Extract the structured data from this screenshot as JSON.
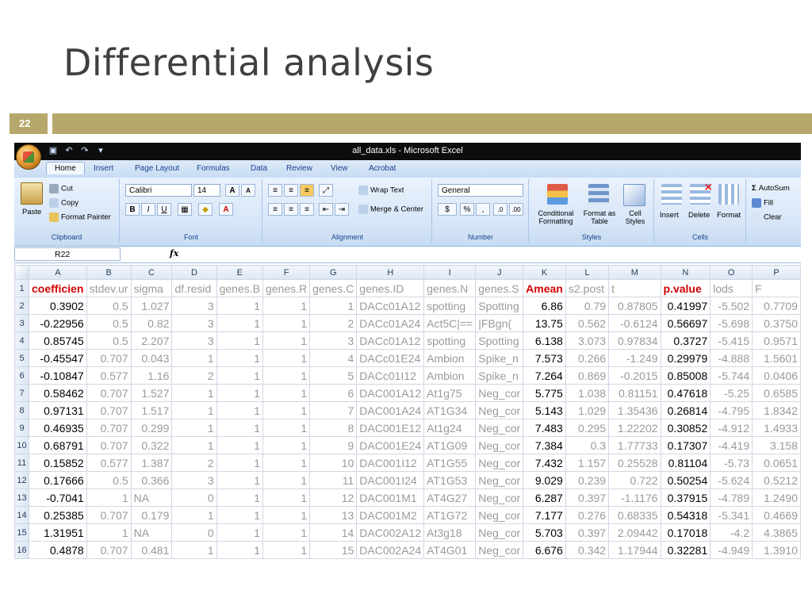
{
  "slide": {
    "title": "Differential analysis",
    "number": "22"
  },
  "window": {
    "title": "all_data.xls - Microsoft Excel"
  },
  "ribbon": {
    "tabs": [
      "Home",
      "Insert",
      "Page Layout",
      "Formulas",
      "Data",
      "Review",
      "View",
      "Acrobat"
    ],
    "clipboard": {
      "paste": "Paste",
      "cut": "Cut",
      "copy": "Copy",
      "format_painter": "Format Painter",
      "label": "Clipboard"
    },
    "font": {
      "name": "Calibri",
      "size": "14",
      "bold": "B",
      "italic": "I",
      "underline": "U",
      "label": "Font"
    },
    "alignment": {
      "wrap": "Wrap Text",
      "merge": "Merge & Center",
      "label": "Alignment"
    },
    "number": {
      "format": "General",
      "currency": "$",
      "percent": "%",
      "comma": ",",
      "label": "Number"
    },
    "styles": {
      "conditional": "Conditional Formatting",
      "as_table": "Format as Table",
      "cell_styles": "Cell Styles",
      "label": "Styles"
    },
    "cells": {
      "insert": "Insert",
      "delete": "Delete",
      "format": "Format",
      "label": "Cells"
    },
    "editing": {
      "autosum": "AutoSum",
      "fill": "Fill",
      "clear": "Clear"
    }
  },
  "formula_bar": {
    "name_box": "R22",
    "fx": "fx",
    "content": ""
  },
  "sheet": {
    "columns": [
      "A",
      "B",
      "C",
      "D",
      "E",
      "F",
      "G",
      "H",
      "I",
      "J",
      "K",
      "L",
      "M",
      "N",
      "O",
      "P"
    ],
    "header_row": [
      "coefficien",
      "stdev.ur",
      "sigma",
      "df.resid",
      "genes.B",
      "genes.R",
      "genes.C",
      "genes.ID",
      "genes.N",
      "genes.S",
      "Amean",
      "s2.post",
      "t",
      "p.value",
      "lods",
      "F"
    ],
    "rows": [
      [
        "0.3902",
        "0.5",
        "1.027",
        "3",
        "1",
        "1",
        "1",
        "DACc01A12",
        "spotting",
        "Spotting",
        "6.86",
        "0.79",
        "0.87805",
        "0.41997",
        "-5.502",
        "0.7709"
      ],
      [
        "-0.22956",
        "0.5",
        "0.82",
        "3",
        "1",
        "1",
        "2",
        "DACc01A24",
        "Act5C|==",
        "|FBgn(",
        "13.75",
        "0.562",
        "-0.6124",
        "0.56697",
        "-5.698",
        "0.3750"
      ],
      [
        "0.85745",
        "0.5",
        "2.207",
        "3",
        "1",
        "1",
        "3",
        "DACc01A12",
        "spotting",
        "Spotting",
        "6.138",
        "3.073",
        "0.97834",
        "0.3727",
        "-5.415",
        "0.9571"
      ],
      [
        "-0.45547",
        "0.707",
        "0.043",
        "1",
        "1",
        "1",
        "4",
        "DACc01E24",
        "Ambion",
        "Spike_n",
        "7.573",
        "0.266",
        "-1.249",
        "0.29979",
        "-4.888",
        "1.5601"
      ],
      [
        "-0.10847",
        "0.577",
        "1.16",
        "2",
        "1",
        "1",
        "5",
        "DACc01I12",
        "Ambion",
        "Spike_n",
        "7.264",
        "0.869",
        "-0.2015",
        "0.85008",
        "-5.744",
        "0.0406"
      ],
      [
        "0.58462",
        "0.707",
        "1.527",
        "1",
        "1",
        "1",
        "6",
        "DAC001A12",
        "At1g75",
        "Neg_cor",
        "5.775",
        "1.038",
        "0.81151",
        "0.47618",
        "-5.25",
        "0.6585"
      ],
      [
        "0.97131",
        "0.707",
        "1.517",
        "1",
        "1",
        "1",
        "7",
        "DAC001A24",
        "AT1G34",
        "Neg_cor",
        "5.143",
        "1.029",
        "1.35436",
        "0.26814",
        "-4.795",
        "1.8342"
      ],
      [
        "0.46935",
        "0.707",
        "0.299",
        "1",
        "1",
        "1",
        "8",
        "DAC001E12",
        "At1g24",
        "Neg_cor",
        "7.483",
        "0.295",
        "1.22202",
        "0.30852",
        "-4.912",
        "1.4933"
      ],
      [
        "0.68791",
        "0.707",
        "0.322",
        "1",
        "1",
        "1",
        "9",
        "DAC001E24",
        "AT1G09",
        "Neg_cor",
        "7.384",
        "0.3",
        "1.77733",
        "0.17307",
        "-4.419",
        "3.158"
      ],
      [
        "0.15852",
        "0.577",
        "1.387",
        "2",
        "1",
        "1",
        "10",
        "DAC001I12",
        "AT1G55",
        "Neg_cor",
        "7.432",
        "1.157",
        "0.25528",
        "0.81104",
        "-5.73",
        "0.0651"
      ],
      [
        "0.17666",
        "0.5",
        "0.366",
        "3",
        "1",
        "1",
        "11",
        "DAC001I24",
        "AT1G53",
        "Neg_cor",
        "9.029",
        "0.239",
        "0.722",
        "0.50254",
        "-5.624",
        "0.5212"
      ],
      [
        "-0.7041",
        "1",
        "NA",
        "0",
        "1",
        "1",
        "12",
        "DAC001M1",
        "AT4G27",
        "Neg_cor",
        "6.287",
        "0.397",
        "-1.1176",
        "0.37915",
        "-4.789",
        "1.2490"
      ],
      [
        "0.25385",
        "0.707",
        "0.179",
        "1",
        "1",
        "1",
        "13",
        "DAC001M2",
        "AT1G72",
        "Neg_cor",
        "7.177",
        "0.276",
        "0.68335",
        "0.54318",
        "-5.341",
        "0.4669"
      ],
      [
        "1.31951",
        "1",
        "NA",
        "0",
        "1",
        "1",
        "14",
        "DAC002A12",
        "At3g18",
        "Neg_cor",
        "5.703",
        "0.397",
        "2.09442",
        "0.17018",
        "-4.2",
        "4.3865"
      ],
      [
        "0.4878",
        "0.707",
        "0.481",
        "1",
        "1",
        "1",
        "15",
        "DAC002A24",
        "AT4G01",
        "Neg_cor",
        "6.676",
        "0.342",
        "1.17944",
        "0.32281",
        "-4.949",
        "1.3910"
      ]
    ]
  }
}
